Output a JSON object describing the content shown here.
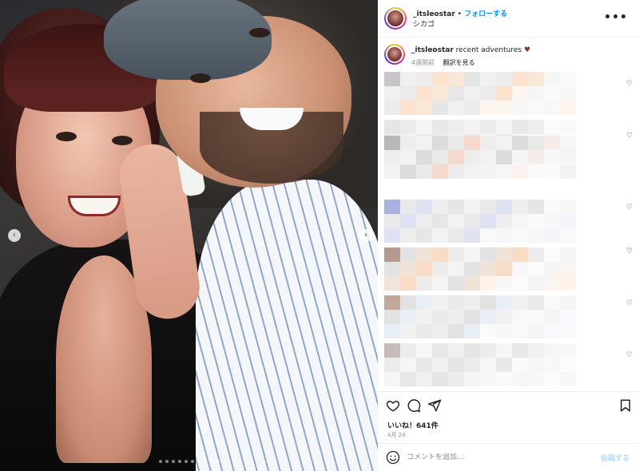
{
  "post": {
    "username": "_itsleostar",
    "separator": "•",
    "follow_label": "フォローする",
    "location": "シカゴ",
    "more_icon": "more-horizontal-icon"
  },
  "caption": {
    "username": "_itsleostar",
    "text": "recent adventures",
    "emoji": "♥",
    "age": "4週間前",
    "translate_label": "翻訳を見る"
  },
  "carousel": {
    "slide_count": 10,
    "active_index": 8
  },
  "actions": {
    "likes": "いいね！641件",
    "date": "4月 24"
  },
  "comment_box": {
    "placeholder": "コメントを追加...",
    "post_label": "投稿する"
  },
  "colors": {
    "accent": "#0095f6",
    "post_disabled": "#b3dbff"
  }
}
